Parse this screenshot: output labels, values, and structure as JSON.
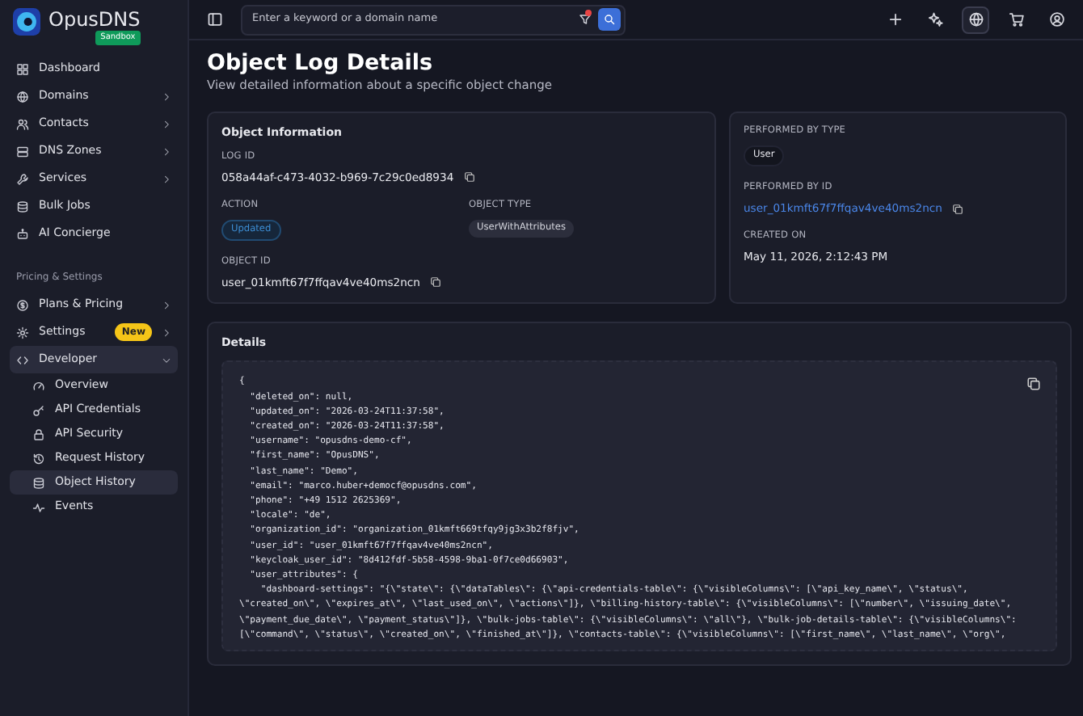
{
  "brand": {
    "name": "OpusDNS",
    "badge": "Sandbox"
  },
  "sidebar": {
    "items": [
      {
        "label": "Dashboard",
        "has_children": false
      },
      {
        "label": "Domains",
        "has_children": true
      },
      {
        "label": "Contacts",
        "has_children": true
      },
      {
        "label": "DNS Zones",
        "has_children": true
      },
      {
        "label": "Services",
        "has_children": true
      },
      {
        "label": "Bulk Jobs",
        "has_children": false
      },
      {
        "label": "AI Concierge",
        "has_children": false
      }
    ],
    "section_label": "Pricing & Settings",
    "settings_items": [
      {
        "label": "Plans & Pricing",
        "has_children": true,
        "expanded": false
      },
      {
        "label": "Settings",
        "badge": "New",
        "has_children": true,
        "expanded": false
      },
      {
        "label": "Developer",
        "has_children": true,
        "expanded": true,
        "children": [
          {
            "label": "Overview",
            "selected": false
          },
          {
            "label": "API Credentials",
            "selected": false
          },
          {
            "label": "API Security",
            "selected": false
          },
          {
            "label": "Request History",
            "selected": false
          },
          {
            "label": "Object History",
            "selected": true
          },
          {
            "label": "Events",
            "selected": false
          }
        ]
      }
    ]
  },
  "topbar": {
    "search": {
      "placeholder": "Enter a keyword or a domain name"
    },
    "filter_active": true,
    "actions": [
      {
        "selected": false
      },
      {
        "selected": false
      },
      {
        "selected": true
      },
      {
        "selected": false
      },
      {
        "selected": false
      }
    ]
  },
  "page": {
    "title": "Object Log Details",
    "subtitle": "View detailed information about a specific object change"
  },
  "object_information": {
    "title": "Object Information",
    "log_id_label": "LOG ID",
    "log_id": "058a44af-c473-4032-b969-7c29c0ed8934",
    "action_label": "ACTION",
    "action": "Updated",
    "object_type_label": "OBJECT TYPE",
    "object_type": "UserWithAttributes",
    "object_id_label": "OBJECT ID",
    "object_id": "user_01kmft67f7ffqav4ve40ms2ncn"
  },
  "performer": {
    "type_label": "PERFORMED BY TYPE",
    "type": "User",
    "id_label": "PERFORMED BY ID",
    "id": "user_01kmft67f7ffqav4ve40ms2ncn",
    "created_label": "CREATED ON",
    "created": "May 11, 2026, 2:12:43 PM"
  },
  "details": {
    "title": "Details",
    "lines": [
      "{",
      "  \"deleted_on\": null,",
      "  \"updated_on\": \"2026-03-24T11:37:58\",",
      "  \"created_on\": \"2026-03-24T11:37:58\",",
      "  \"username\": \"opusdns-demo-cf\",",
      "  \"first_name\": \"OpusDNS\",",
      "  \"last_name\": \"Demo\",",
      "  \"email\": \"marco.huber+democf@opusdns.com\",",
      "  \"phone\": \"+49 1512 2625369\",",
      "  \"locale\": \"de\",",
      "  \"organization_id\": \"organization_01kmft669tfqy9jg3x3b2f8fjv\",",
      "  \"user_id\": \"user_01kmft67f7ffqav4ve40ms2ncn\",",
      "  \"keycloak_user_id\": \"8d412fdf-5b58-4598-9ba1-0f7ce0d66903\",",
      "  \"user_attributes\": {",
      "    \"dashboard-settings\": \"{\\\"state\\\": {\\\"dataTables\\\": {\\\"api-credentials-table\\\": {\\\"visibleColumns\\\": [\\\"api_key_name\\\", \\\"status\\\",",
      "\\\"created_on\\\", \\\"expires_at\\\", \\\"last_used_on\\\", \\\"actions\\\"]}, \\\"billing-history-table\\\": {\\\"visibleColumns\\\": [\\\"number\\\", \\\"issuing_date\\\",",
      "\\\"payment_due_date\\\", \\\"payment_status\\\"]}, \\\"bulk-jobs-table\\\": {\\\"visibleColumns\\\": \\\"all\\\"}, \\\"bulk-job-details-table\\\": {\\\"visibleColumns\\\":",
      "[\\\"command\\\", \\\"status\\\", \\\"created_on\\\", \\\"finished_at\\\"]}, \\\"contacts-table\\\": {\\\"visibleColumns\\\": [\\\"first_name\\\", \\\"last_name\\\", \\\"org\\\","
    ]
  }
}
